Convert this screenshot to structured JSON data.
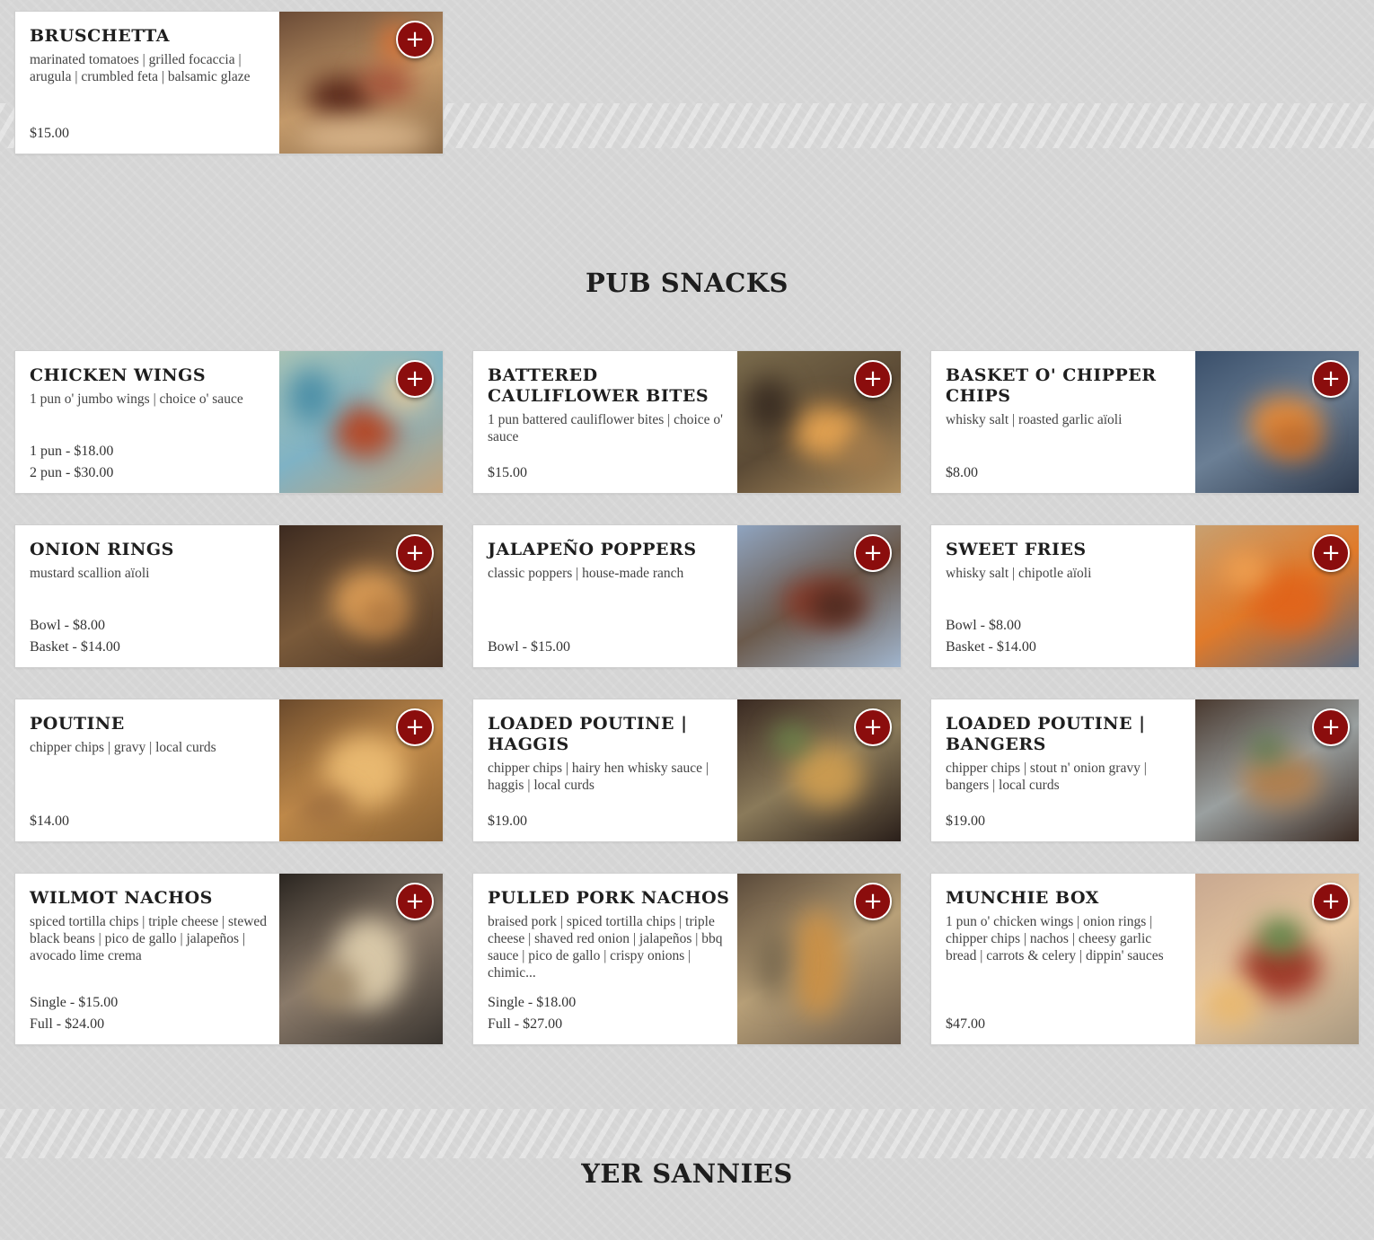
{
  "sections": {
    "pub_snacks": "PUB SNACKS",
    "yer_sannies": "YER SANNIES"
  },
  "add_icon": "+",
  "colors": {
    "accent": "#8b0d0d",
    "card_bg": "#ffffff",
    "page_bg": "#dcdcdc"
  },
  "items": [
    {
      "title": "BRUSCHETTA",
      "desc": "marinated tomatoes | grilled focaccia | arugula | crumbled feta | balsamic glaze",
      "prices": [
        "$15.00"
      ]
    },
    {
      "title": "CHICKEN WINGS",
      "desc": "1 pun o' jumbo wings | choice o' sauce",
      "prices": [
        "1 pun - $18.00",
        "2 pun - $30.00"
      ]
    },
    {
      "title": "BATTERED CAULIFLOWER BITES",
      "desc": "1 pun battered cauliflower bites | choice o' sauce",
      "prices": [
        "$15.00"
      ]
    },
    {
      "title": "BASKET O' CHIPPER CHIPS",
      "desc": "whisky salt | roasted garlic aïoli",
      "prices": [
        "$8.00"
      ]
    },
    {
      "title": "ONION RINGS",
      "desc": "mustard scallion aïoli",
      "prices": [
        "Bowl - $8.00",
        "Basket - $14.00"
      ]
    },
    {
      "title": "JALAPEÑO POPPERS",
      "desc": "classic poppers | house-made ranch",
      "prices": [
        "Bowl - $15.00"
      ]
    },
    {
      "title": "SWEET FRIES",
      "desc": "whisky salt | chipotle aïoli",
      "prices": [
        "Bowl - $8.00",
        "Basket - $14.00"
      ]
    },
    {
      "title": "POUTINE",
      "desc": "chipper chips | gravy | local curds",
      "prices": [
        "$14.00"
      ]
    },
    {
      "title": "LOADED POUTINE | HAGGIS",
      "desc": "chipper chips | hairy hen whisky sauce | haggis | local curds",
      "prices": [
        "$19.00"
      ]
    },
    {
      "title": "LOADED POUTINE | BANGERS",
      "desc": "chipper chips | stout n' onion gravy | bangers | local curds",
      "prices": [
        "$19.00"
      ]
    },
    {
      "title": "WILMOT NACHOS",
      "desc": "spiced tortilla chips | triple cheese | stewed black beans | pico de gallo | jalapeños | avocado lime crema",
      "prices": [
        "Single - $15.00",
        "Full - $24.00"
      ]
    },
    {
      "title": "PULLED PORK NACHOS",
      "desc": "braised pork | spiced tortilla chips | triple cheese | shaved red onion | jalapeños | bbq sauce | pico de gallo | crispy onions | chimic...",
      "prices": [
        "Single - $18.00",
        "Full - $27.00"
      ]
    },
    {
      "title": "MUNCHIE BOX",
      "desc": "1 pun o' chicken wings | onion rings | chipper chips | nachos | cheesy garlic bread | carrots & celery | dippin' sauces",
      "prices": [
        "$47.00"
      ]
    }
  ]
}
